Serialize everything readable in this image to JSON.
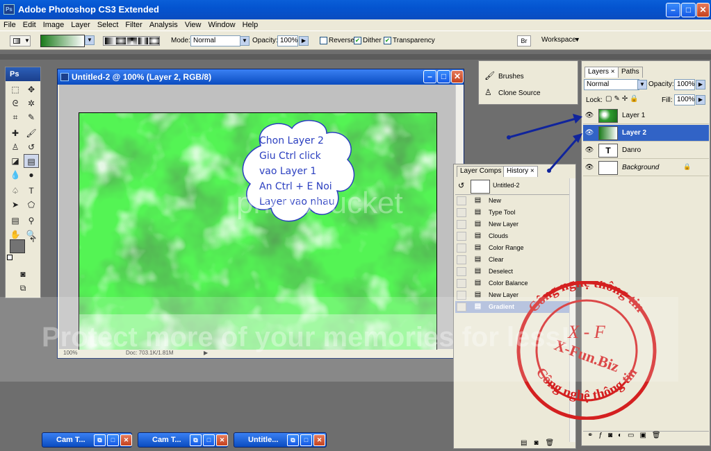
{
  "app": {
    "title": "Adobe Photoshop CS3 Extended",
    "badge": "Ps"
  },
  "menu": [
    "File",
    "Edit",
    "Image",
    "Layer",
    "Select",
    "Filter",
    "Analysis",
    "View",
    "Window",
    "Help"
  ],
  "options": {
    "mode_label": "Mode:",
    "mode_value": "Normal",
    "opacity_label": "Opacity:",
    "opacity_value": "100%",
    "reverse_label": "Reverse",
    "dither_label": "Dither",
    "transparency_label": "Transparency",
    "reverse_checked": false,
    "dither_checked": true,
    "transparency_checked": true,
    "workspace_label": "Workspace",
    "gradient_colors": [
      "#1a7a1a",
      "#ffffff"
    ]
  },
  "toolbox": {
    "header": "Ps"
  },
  "document": {
    "title": "Untitled-2 @ 100% (Layer 2, RGB/8)",
    "zoom": "100%",
    "doc_info": "Doc: 703.1K/1.81M",
    "bubble_lines": [
      "Chon Layer 2",
      "Giu Ctrl click",
      "vao Layer 1",
      "An Ctrl + E Noi",
      "Layer vao nhau"
    ],
    "canvas_color": "#3a9b3a"
  },
  "brush_panel": {
    "items": [
      "Brushes",
      "Clone Source"
    ]
  },
  "layers_panel": {
    "tabs": [
      "Layers",
      "Paths"
    ],
    "blend_mode": "Normal",
    "opacity_label": "Opacity:",
    "opacity_value": "100%",
    "lock_label": "Lock:",
    "fill_label": "Fill:",
    "fill_value": "100%",
    "layers": [
      {
        "name": "Layer 1",
        "selected": false,
        "thumb": "clouds"
      },
      {
        "name": "Layer 2",
        "selected": true,
        "thumb": "gradient"
      },
      {
        "name": "Danro",
        "selected": false,
        "thumb": "text"
      },
      {
        "name": "Background",
        "selected": false,
        "thumb": "white",
        "locked": true
      }
    ]
  },
  "history_panel": {
    "tabs": [
      "Layer Comps",
      "History"
    ],
    "snapshot": "Untitled-2",
    "states": [
      "New",
      "Type Tool",
      "New Layer",
      "Clouds",
      "Color Range",
      "Clear",
      "Deselect",
      "Color Balance",
      "New Layer",
      "Gradient"
    ],
    "active_state": "Gradient"
  },
  "taskbar": {
    "items": [
      "Cam T...",
      "Cam T...",
      "Untitle..."
    ]
  },
  "watermarks": {
    "line1": "Protect more of your memories for less!",
    "line2": "photobucket"
  },
  "stamp": {
    "outer_top": "Công nghệ thông tin",
    "outer_bottom": "Công nghệ thông tin",
    "center_top": "X - F",
    "center": "X-Fun.Biz",
    "color": "#d42020"
  },
  "colors": {
    "title_blue": "#0a4cc0",
    "panel_bg": "#ece9d8",
    "workspace_gray": "#6e6e6e",
    "arrow": "#10249c"
  }
}
